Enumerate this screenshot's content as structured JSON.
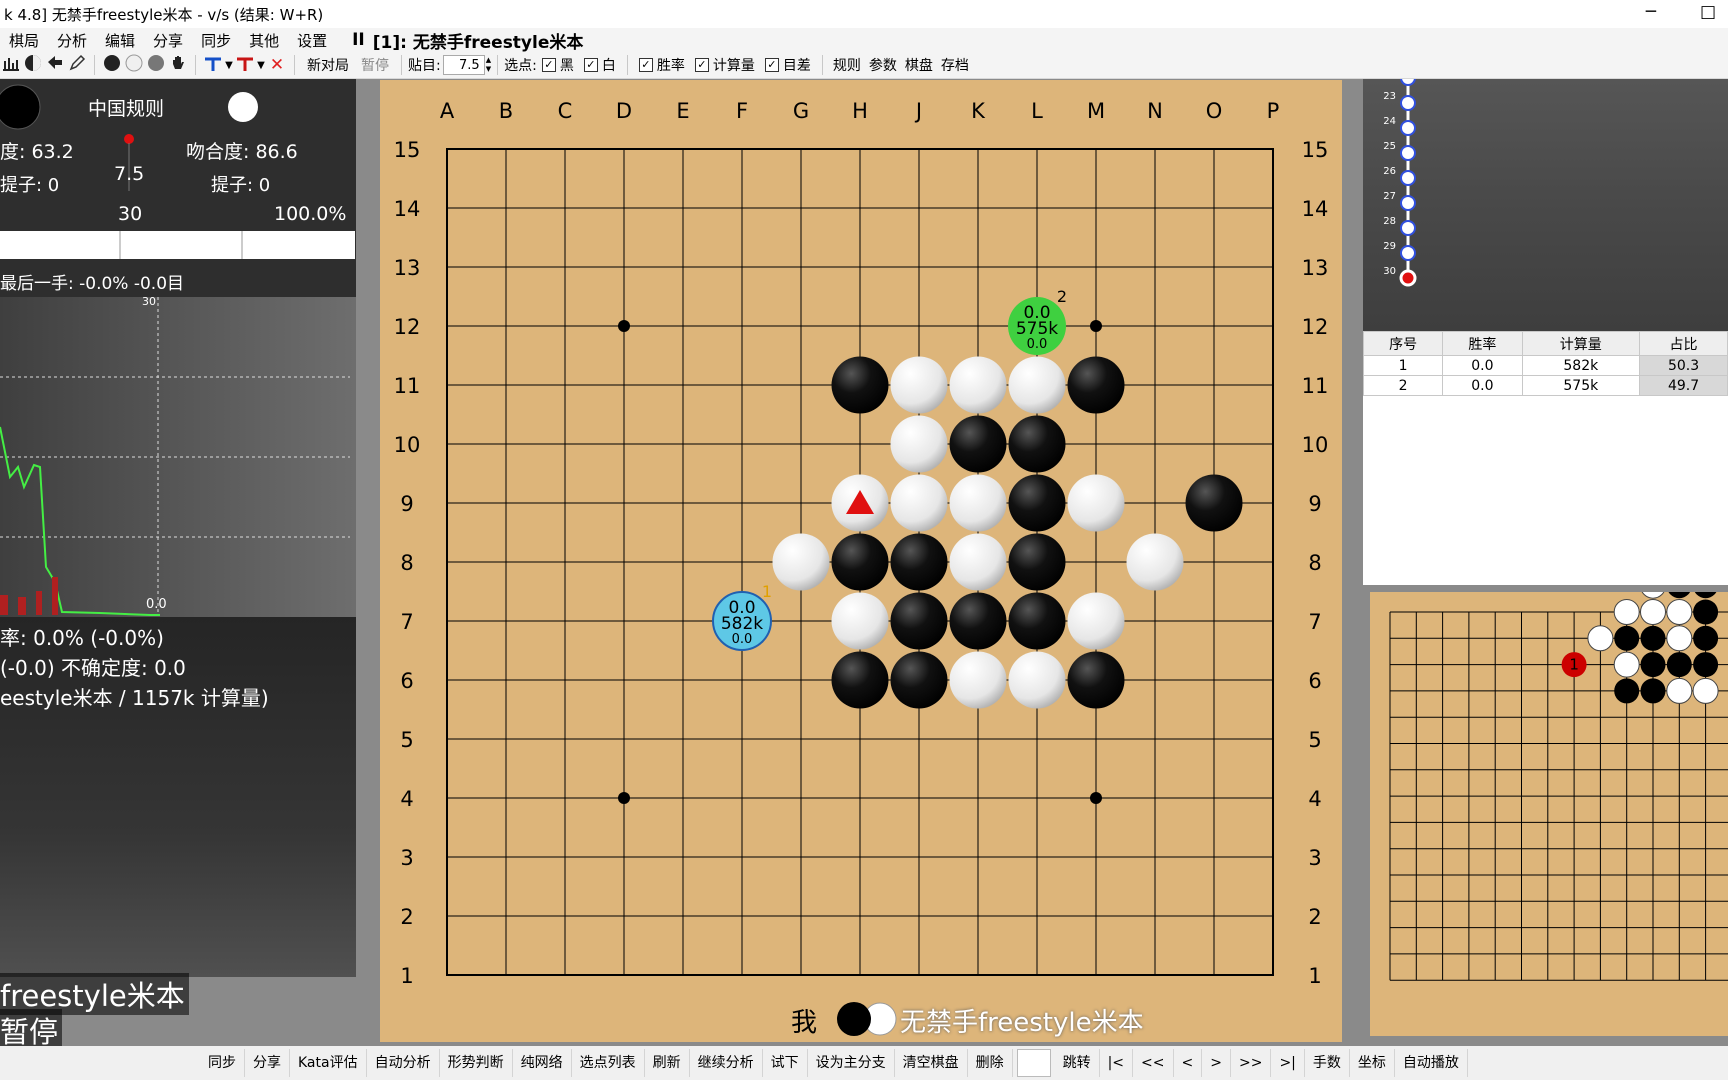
{
  "window": {
    "title": "k 4.8] 无禁手freestyle米本 - v/s (结果: W+R)",
    "minimize": "─",
    "restore": "□"
  },
  "menu": {
    "items": [
      "棋局",
      "分析",
      "编辑",
      "分享",
      "同步",
      "其他",
      "设置"
    ],
    "pause_glyph": "II",
    "game_title": "[1]: 无禁手freestyle米本"
  },
  "toolbar": {
    "new_game": "新对局",
    "pause": "暂停",
    "komi_label": "贴目:",
    "komi_value": "7.5",
    "select_label": "选点:",
    "black": "黑",
    "white": "白",
    "winrate": "胜率",
    "playouts": "计算量",
    "score": "目差",
    "rules": "规则",
    "params": "参数",
    "board": "棋盘",
    "save": "存档"
  },
  "left_panel": {
    "rule": "中国规则",
    "black_match": "度: 63.2",
    "white_match": "吻合度: 86.6",
    "black_captures": "提子: 0",
    "white_captures": "提子: 0",
    "komi": "7.5",
    "moves": "30",
    "winrate_pct": "100.0%",
    "last_move": "最后一手: -0.0% -0.0目",
    "chart_top": "30",
    "chart_end": "0.0",
    "line1": "率: 0.0% (-0.0%)",
    "line2": "(-0.0) 不确定度: 0.0",
    "line3": "eestyle米本 / 1157k 计算量)",
    "player_name": "freestyle米本",
    "status": "暂停"
  },
  "board": {
    "columns": [
      "A",
      "B",
      "C",
      "D",
      "E",
      "F",
      "G",
      "H",
      "J",
      "K",
      "L",
      "M",
      "N",
      "O",
      "P"
    ],
    "rows": [
      "15",
      "14",
      "13",
      "12",
      "11",
      "10",
      "9",
      "8",
      "7",
      "6",
      "5",
      "4",
      "3",
      "2",
      "1"
    ],
    "stars": [
      "D12",
      "M12",
      "D4",
      "M4"
    ],
    "black_stones": [
      "H11",
      "M11",
      "K10",
      "L10",
      "L9",
      "O9",
      "H8",
      "J8",
      "L8",
      "J7",
      "K7",
      "L7",
      "H6",
      "J6",
      "M6"
    ],
    "white_stones": [
      "J11",
      "K11",
      "L11",
      "J10",
      "H9",
      "J9",
      "K9",
      "M9",
      "G8",
      "K8",
      "N8",
      "H7",
      "M7",
      "K6",
      "L6"
    ],
    "last_move": "H9",
    "candidates": [
      {
        "pos": "F7",
        "rank": "1",
        "winrate": "0.0",
        "playouts": "582k",
        "score": "0.0",
        "color": "#5ec8e6"
      },
      {
        "pos": "L12",
        "rank": "2",
        "winrate": "0.0",
        "playouts": "575k",
        "score": "0.0",
        "color": "#3fd040"
      }
    ],
    "footer_me": "我",
    "footer_opponent": "无禁手freestyle米本"
  },
  "move_tree": {
    "nodes": [
      "22",
      "23",
      "24",
      "25",
      "26",
      "27",
      "28",
      "29",
      "30"
    ]
  },
  "candidate_table": {
    "headers": [
      "序号",
      "胜率",
      "计算量",
      "占比"
    ],
    "rows": [
      [
        "1",
        "0.0",
        "582k",
        "50.3"
      ],
      [
        "2",
        "0.0",
        "575k",
        "49.7"
      ]
    ]
  },
  "mini_board": {
    "rank1": "1",
    "rank2": "2"
  },
  "bottom": {
    "buttons": [
      "同步",
      "分享",
      "Kata评估",
      "自动分析",
      "形势判断",
      "纯网络",
      "选点列表",
      "刷新",
      "继续分析",
      "试下",
      "设为主分支",
      "清空棋盘",
      "删除"
    ],
    "nav": [
      "跳转",
      "|<",
      "<<",
      "<",
      ">",
      ">>",
      ">|",
      "手数",
      "坐标",
      "自动播放"
    ]
  },
  "colors": {
    "board": "#ddb57a",
    "last_move_marker": "#e01010",
    "chart_line": "#44ee44"
  }
}
